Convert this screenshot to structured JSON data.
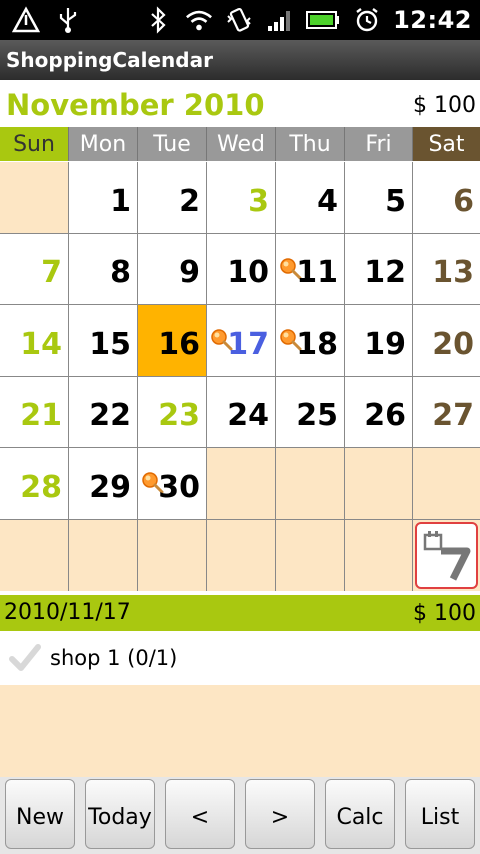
{
  "status": {
    "time": "12:42"
  },
  "app": {
    "title": "ShoppingCalendar"
  },
  "month": {
    "title": "November 2010",
    "total": "$ 100"
  },
  "weekdays": [
    "Sun",
    "Mon",
    "Tue",
    "Wed",
    "Thu",
    "Fri",
    "Sat"
  ],
  "weeks": [
    [
      {
        "day": ""
      },
      {
        "day": "1"
      },
      {
        "day": "2"
      },
      {
        "day": "3",
        "style": "holiday"
      },
      {
        "day": "4"
      },
      {
        "day": "5"
      },
      {
        "day": "6",
        "style": "sat"
      }
    ],
    [
      {
        "day": "7",
        "style": "sun"
      },
      {
        "day": "8"
      },
      {
        "day": "9"
      },
      {
        "day": "10"
      },
      {
        "day": "11",
        "mark": true
      },
      {
        "day": "12"
      },
      {
        "day": "13",
        "style": "sat"
      }
    ],
    [
      {
        "day": "14",
        "style": "sun"
      },
      {
        "day": "15"
      },
      {
        "day": "16",
        "today": true
      },
      {
        "day": "17",
        "mark": true,
        "style": "selected"
      },
      {
        "day": "18",
        "mark": true
      },
      {
        "day": "19"
      },
      {
        "day": "20",
        "style": "sat"
      }
    ],
    [
      {
        "day": "21",
        "style": "sun"
      },
      {
        "day": "22"
      },
      {
        "day": "23",
        "style": "holiday"
      },
      {
        "day": "24"
      },
      {
        "day": "25"
      },
      {
        "day": "26"
      },
      {
        "day": "27",
        "style": "sat"
      }
    ],
    [
      {
        "day": "28",
        "style": "sun"
      },
      {
        "day": "29"
      },
      {
        "day": "30",
        "mark": true
      },
      {
        "day": ""
      },
      {
        "day": ""
      },
      {
        "day": ""
      },
      {
        "day": ""
      }
    ],
    [
      {
        "day": ""
      },
      {
        "day": ""
      },
      {
        "day": ""
      },
      {
        "day": ""
      },
      {
        "day": ""
      },
      {
        "day": ""
      },
      {
        "day": "",
        "today_button": true
      }
    ]
  ],
  "selected_day": {
    "date": "2010/11/17",
    "total": "$ 100"
  },
  "shop_items": [
    {
      "label": "shop 1 (0/1)",
      "checked": false
    }
  ],
  "toolbar": {
    "new_label": "New",
    "today_label": "Today",
    "prev_label": "<",
    "next_label": ">",
    "calc_label": "Calc",
    "list_label": "List"
  },
  "colors": {
    "accent_green": "#a9c810",
    "saturday_brown": "#6a5430",
    "today_orange": "#ffb300",
    "empty_cell": "#fde6c4",
    "selected_blue": "#4a5fe0"
  },
  "icons": {
    "status": [
      "alert-icon",
      "usb-icon",
      "bluetooth-icon",
      "wifi-icon",
      "vibrate-icon",
      "signal-icon",
      "battery-icon",
      "alarm-icon"
    ],
    "mark": "shopping-mark-icon",
    "today_button": "calendar-today-icon"
  }
}
